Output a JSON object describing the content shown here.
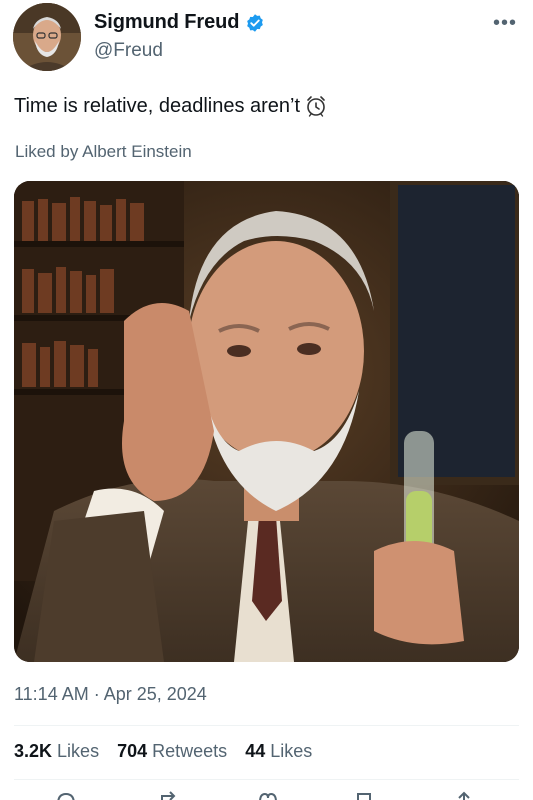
{
  "profile": {
    "display_name": "Sigmund Freud",
    "handle": "@Freud",
    "verified_icon": "verified-badge-icon",
    "avatar_icon": "avatar"
  },
  "menu": {
    "more_label": "•••"
  },
  "tweet": {
    "text": "Time is relative, deadlines aren’t",
    "emoji": "alarm-clock-icon",
    "liked_by": "Liked by Albert Einstein"
  },
  "meta": {
    "timestamp": "11:14 AM · Apr 25, 2024"
  },
  "stats": [
    {
      "value": "3.2K",
      "label": "Likes"
    },
    {
      "value": "704",
      "label": "Retweets"
    },
    {
      "value": "44",
      "label": "Likes"
    }
  ],
  "actions": [
    "reply-icon",
    "retweet-icon",
    "like-icon",
    "bookmark-icon",
    "share-icon"
  ],
  "colors": {
    "accent": "#1d9bf0",
    "text": "#0f1419",
    "muted": "#536471"
  }
}
